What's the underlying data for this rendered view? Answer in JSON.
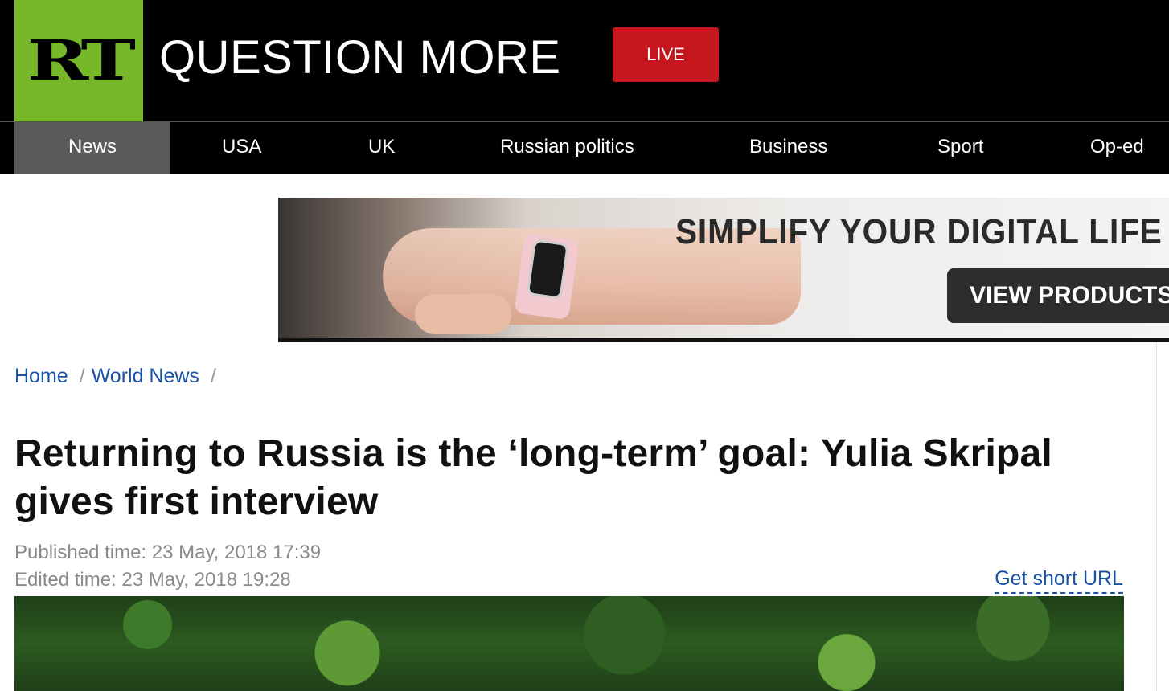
{
  "header": {
    "logo_text": "RT",
    "tagline": "QUESTION MORE",
    "live_label": "LIVE",
    "brand_green": "#77b82a",
    "live_red": "#c4161c"
  },
  "nav": {
    "items": [
      {
        "label": "News",
        "active": true
      },
      {
        "label": "USA"
      },
      {
        "label": "UK"
      },
      {
        "label": "Russian politics"
      },
      {
        "label": "Business"
      },
      {
        "label": "Sport"
      },
      {
        "label": "Op-ed"
      }
    ]
  },
  "ad": {
    "headline": "SIMPLIFY YOUR DIGITAL LIFE",
    "cta": "VIEW PRODUCTS"
  },
  "breadcrumb": {
    "items": [
      "Home",
      "World News"
    ],
    "separator": "/"
  },
  "article": {
    "title": "Returning to Russia is the ‘long-term’ goal: Yulia Skripal gives first interview",
    "published": "Published time: 23 May, 2018 17:39",
    "edited": "Edited time: 23 May, 2018 19:28",
    "short_url_label": "Get short URL",
    "link_color": "#1a53a6"
  }
}
